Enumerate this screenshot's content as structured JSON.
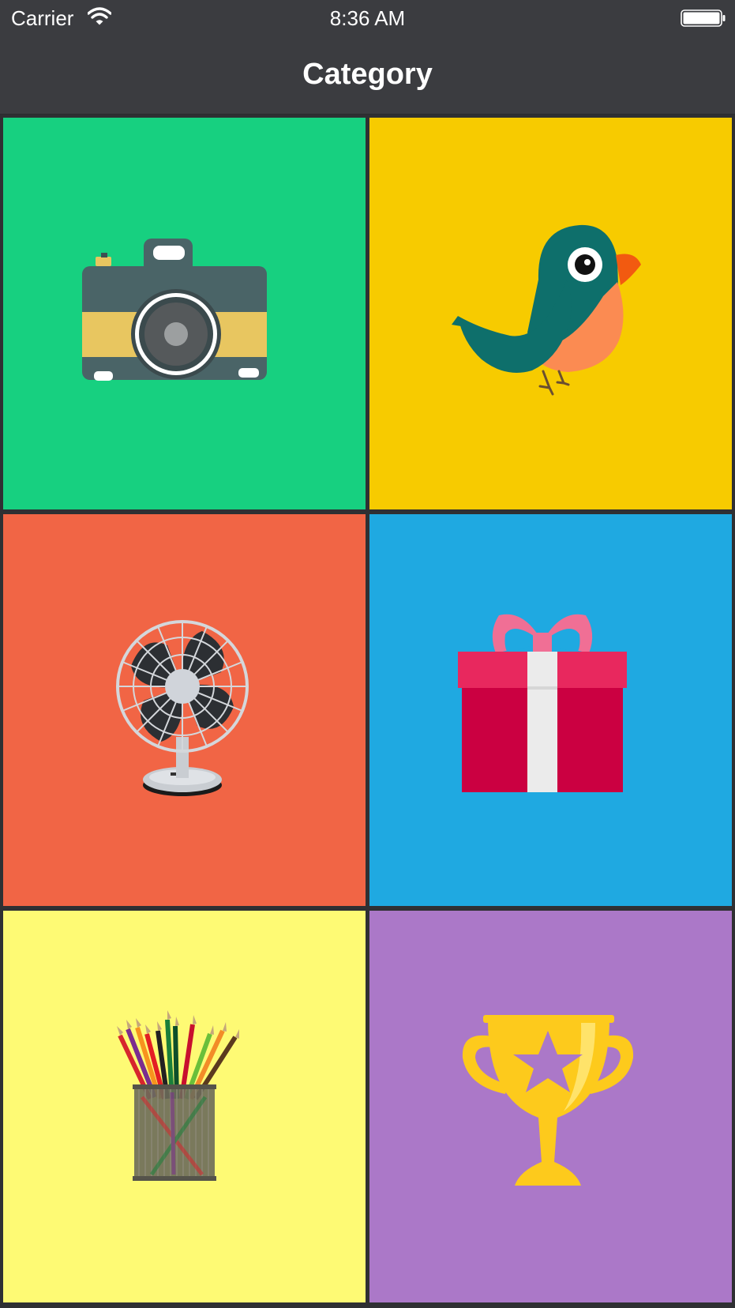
{
  "status_bar": {
    "carrier": "Carrier",
    "time": "8:36 AM",
    "wifi_icon": "wifi-icon",
    "battery_icon": "battery-icon"
  },
  "nav": {
    "title": "Category"
  },
  "categories": [
    {
      "icon": "camera-icon",
      "color": "#17d080"
    },
    {
      "icon": "bird-icon",
      "color": "#f7cb00"
    },
    {
      "icon": "fan-icon",
      "color": "#f16545"
    },
    {
      "icon": "gift-icon",
      "color": "#1fa9e1"
    },
    {
      "icon": "pencil-cup-icon",
      "color": "#fefa74"
    },
    {
      "icon": "trophy-icon",
      "color": "#ab78c8"
    }
  ]
}
